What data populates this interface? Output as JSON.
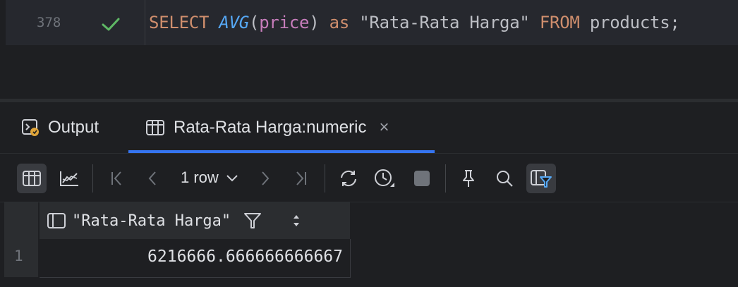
{
  "editor": {
    "line_number": "378",
    "status_icon": "check-icon",
    "tokens": {
      "select": "SELECT",
      "avg": "AVG",
      "open_paren": "(",
      "column": "price",
      "close_paren": ")",
      "as": "as",
      "alias": "\"Rata-Rata Harga\"",
      "from": "FROM",
      "table": "products;"
    }
  },
  "tabs": [
    {
      "label": "Output",
      "icon": "console-icon"
    },
    {
      "label": "Rata-Rata Harga:numeric",
      "icon": "table-icon",
      "close": "×"
    }
  ],
  "toolbar": {
    "row_count_label": "1 row"
  },
  "grid": {
    "columns": [
      {
        "header": "\"Rata-Rata Harga\""
      }
    ],
    "rows": [
      {
        "num": "1",
        "values": [
          "6216666.666666666667"
        ]
      }
    ]
  },
  "colors": {
    "accent": "#3574f0",
    "check": "#5fb865",
    "keyword": "#cf8e6d",
    "function": "#56a8f5",
    "string": "#6aab73"
  }
}
